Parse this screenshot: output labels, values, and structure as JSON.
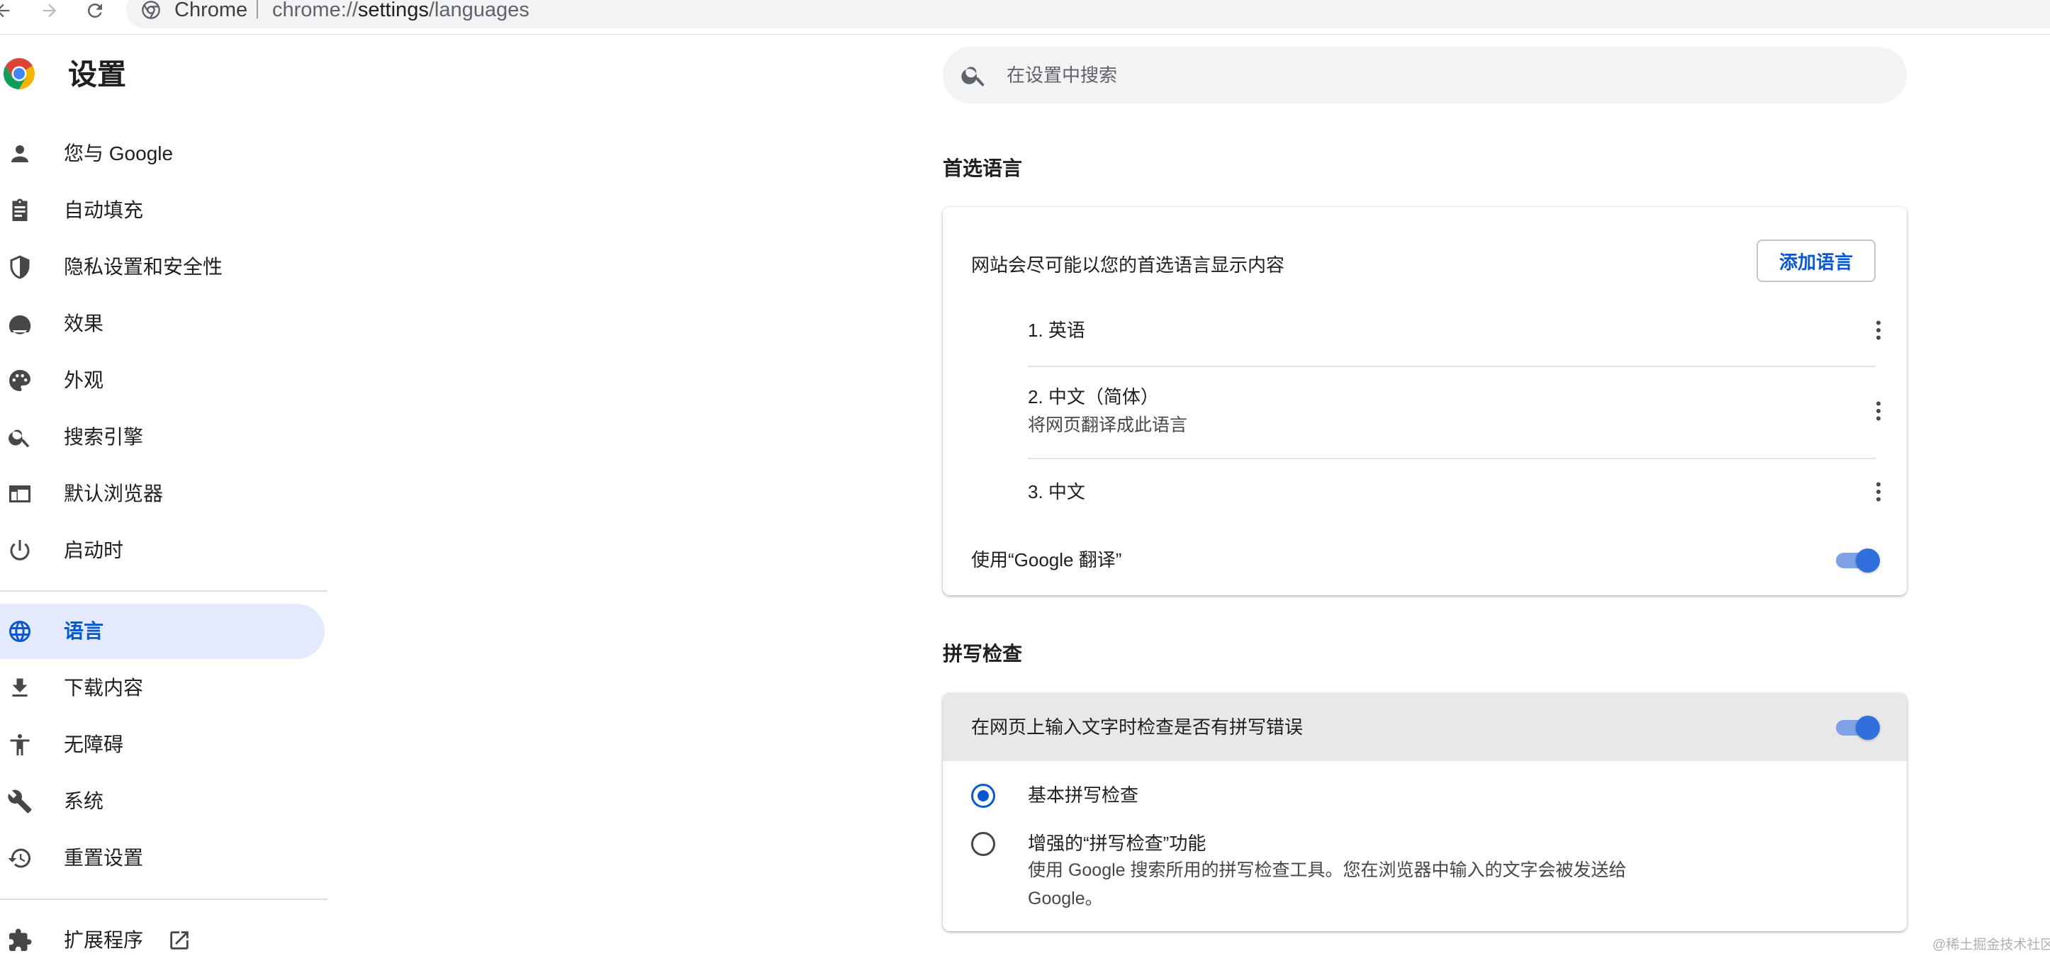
{
  "browser": {
    "site_name": "Chrome",
    "url_prefix": "chrome://",
    "url_host": "settings",
    "url_path": "/languages"
  },
  "header": {
    "title": "设置"
  },
  "sidebar": {
    "items": [
      {
        "label": "您与 Google",
        "icon": "person-icon"
      },
      {
        "label": "自动填充",
        "icon": "clipboard-icon"
      },
      {
        "label": "隐私设置和安全性",
        "icon": "shield-icon"
      },
      {
        "label": "效果",
        "icon": "speedometer-icon"
      },
      {
        "label": "外观",
        "icon": "palette-icon"
      },
      {
        "label": "搜索引擎",
        "icon": "search-icon"
      },
      {
        "label": "默认浏览器",
        "icon": "browser-window-icon"
      },
      {
        "label": "启动时",
        "icon": "power-icon"
      },
      {
        "label": "语言",
        "icon": "globe-icon",
        "active": true
      },
      {
        "label": "下载内容",
        "icon": "download-icon"
      },
      {
        "label": "无障碍",
        "icon": "accessibility-icon"
      },
      {
        "label": "系统",
        "icon": "wrench-icon"
      },
      {
        "label": "重置设置",
        "icon": "history-icon"
      },
      {
        "label": "扩展程序",
        "icon": "puzzle-icon"
      }
    ]
  },
  "search": {
    "placeholder": "在设置中搜索"
  },
  "preferred": {
    "title": "首选语言",
    "description": "网站会尽可能以您的首选语言显示内容",
    "add_button": "添加语言",
    "languages": [
      {
        "name": "1. 英语",
        "note": ""
      },
      {
        "name": "2. 中文（简体）",
        "note": "将网页翻译成此语言"
      },
      {
        "name": "3. 中文",
        "note": ""
      }
    ],
    "translate_label": "使用“Google 翻译”",
    "translate_enabled": true
  },
  "spellcheck": {
    "title": "拼写检查",
    "toggle_label": "在网页上输入文字时检查是否有拼写错误",
    "toggle_enabled": true,
    "options": [
      {
        "label": "基本拼写检查",
        "selected": true,
        "description": ""
      },
      {
        "label": "增强的“拼写检查”功能",
        "selected": false,
        "description_line1": "使用 Google 搜索所用的拼写检查工具。您在浏览器中输入的文字会被发送给",
        "description_line2": "Google。"
      }
    ]
  },
  "colors": {
    "accent": "#0b57d0",
    "active_bg": "#e3eafd",
    "toggle_knob": "#2f6fde"
  },
  "watermark": "@稀土掘金技术社区"
}
